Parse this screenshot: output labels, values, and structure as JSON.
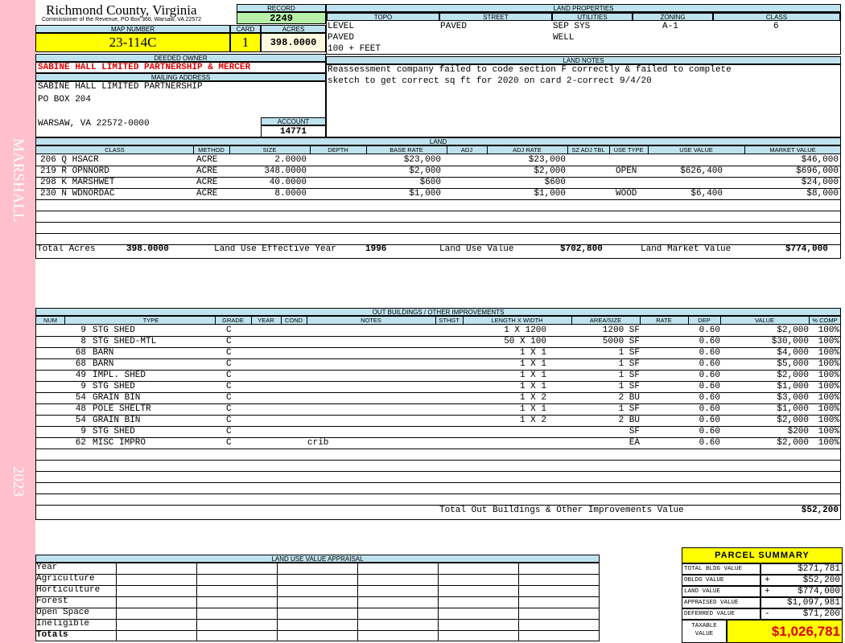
{
  "side": {
    "top": "MARSHALL",
    "bottom": "2023"
  },
  "county": {
    "title": "Richmond County, Virginia",
    "subtitle": "Commissioner of the Revenue, PO Box 366, Warsaw, VA 22572"
  },
  "record": {
    "label": "RECORD",
    "value": "2249"
  },
  "map": {
    "label": "MAP NUMBER",
    "value": "23-114C"
  },
  "card": {
    "label": "CARD",
    "value": "1"
  },
  "acres": {
    "label": "ACRES",
    "value": "398.0000"
  },
  "owner": {
    "label": "DEEDED OWNER",
    "value": "SABINE HALL LIMITED PARTNERSHIP & MERCER"
  },
  "mailing": {
    "label": "MAILING ADDRESS",
    "line1": "SABINE HALL LIMITED PARTNERSHIP",
    "line2": "PO BOX 204",
    "line3": "WARSAW, VA 22572-0000"
  },
  "account": {
    "label": "ACCOUNT",
    "value": "14771"
  },
  "land_properties": {
    "label": "LAND PROPERTIES",
    "headers": [
      "TOPO",
      "STREET",
      "UTILITIES",
      "ZONING",
      "CLASS"
    ],
    "topo": [
      "LEVEL",
      "PAVED",
      "100 + FEET"
    ],
    "street": "PAVED",
    "utilities": [
      "SEP SYS",
      "WELL"
    ],
    "zoning": "A-1",
    "class": "6"
  },
  "land_notes": {
    "label": "LAND NOTES",
    "line1": "Reassessment company failed to code section F correctly & failed to complete",
    "line2": "sketch to get correct sq ft for 2020 on card 2-correct 9/4/20"
  },
  "land": {
    "label": "LAND",
    "headers": [
      "CLASS",
      "METHOD",
      "SIZE",
      "DEPTH",
      "BASE RATE",
      "ADJ",
      "ADJ RATE",
      "SZ ADJ TBL",
      "USE TYPE",
      "USE VALUE",
      "MARKET VALUE"
    ],
    "rows": [
      {
        "class": "206 Q HSACR",
        "method": "ACRE",
        "size": "2.0000",
        "base_rate": "$23,000",
        "adj_rate": "$23,000",
        "use_type": "",
        "use_value": "",
        "market_value": "$46,000"
      },
      {
        "class": "219 R OPNNORD",
        "method": "ACRE",
        "size": "348.0000",
        "base_rate": "$2,000",
        "adj_rate": "$2,000",
        "use_type": "OPEN",
        "use_value": "$626,400",
        "market_value": "$696,000"
      },
      {
        "class": "298 K MARSHWET",
        "method": "ACRE",
        "size": "40.0000",
        "base_rate": "$600",
        "adj_rate": "$600",
        "use_type": "",
        "use_value": "",
        "market_value": "$24,000"
      },
      {
        "class": "230 N WDNORDAC",
        "method": "ACRE",
        "size": "8.0000",
        "base_rate": "$1,000",
        "adj_rate": "$1,000",
        "use_type": "WOOD",
        "use_value": "$6,400",
        "market_value": "$8,000"
      }
    ],
    "total_acres_label": "Total Acres",
    "total_acres": "398.0000",
    "effective_year_label": "Land Use Effective Year",
    "effective_year": "1996",
    "use_value_label": "Land Use Value",
    "use_value": "$702,800",
    "market_value_label": "Land Market Value",
    "market_value": "$774,000"
  },
  "outbuildings": {
    "label": "OUT BUILDINGS / OTHER IMPROVEMENTS",
    "headers": [
      "NUM",
      "TYPE",
      "GRADE",
      "YEAR",
      "COND",
      "NOTES",
      "STHGT",
      "LENGTH X WIDTH",
      "AREA/SIZE",
      "RATE",
      "DEP",
      "VALUE",
      "% COMP"
    ],
    "rows": [
      {
        "num": "9",
        "type": "STG SHED",
        "grade": "C",
        "notes": "",
        "lxw": "1 X 1200",
        "area": "1200 SF",
        "dep": "0.60",
        "value": "$2,000",
        "comp": "100%"
      },
      {
        "num": "8",
        "type": "STG SHED-MTL",
        "grade": "C",
        "notes": "",
        "lxw": "50 X 100",
        "area": "5000 SF",
        "dep": "0.60",
        "value": "$30,000",
        "comp": "100%"
      },
      {
        "num": "68",
        "type": "BARN",
        "grade": "C",
        "notes": "",
        "lxw": "1 X 1",
        "area": "1 SF",
        "dep": "0.60",
        "value": "$4,000",
        "comp": "100%"
      },
      {
        "num": "68",
        "type": "BARN",
        "grade": "C",
        "notes": "",
        "lxw": "1 X 1",
        "area": "1 SF",
        "dep": "0.60",
        "value": "$5,000",
        "comp": "100%"
      },
      {
        "num": "49",
        "type": "IMPL. SHED",
        "grade": "C",
        "notes": "",
        "lxw": "1 X 1",
        "area": "1 SF",
        "dep": "0.60",
        "value": "$2,000",
        "comp": "100%"
      },
      {
        "num": "9",
        "type": "STG SHED",
        "grade": "C",
        "notes": "",
        "lxw": "1 X 1",
        "area": "1 SF",
        "dep": "0.60",
        "value": "$1,000",
        "comp": "100%"
      },
      {
        "num": "54",
        "type": "GRAIN BIN",
        "grade": "C",
        "notes": "",
        "lxw": "1 X 2",
        "area": "2 BU",
        "dep": "0.60",
        "value": "$3,000",
        "comp": "100%"
      },
      {
        "num": "48",
        "type": "POLE SHELTR",
        "grade": "C",
        "notes": "",
        "lxw": "1 X 1",
        "area": "1 SF",
        "dep": "0.60",
        "value": "$1,000",
        "comp": "100%"
      },
      {
        "num": "54",
        "type": "GRAIN BIN",
        "grade": "C",
        "notes": "",
        "lxw": "1 X 2",
        "area": "2 BU",
        "dep": "0.60",
        "value": "$2,000",
        "comp": "100%"
      },
      {
        "num": "9",
        "type": "STG SHED",
        "grade": "C",
        "notes": "",
        "lxw": "",
        "area": "SF",
        "dep": "0.60",
        "value": "$200",
        "comp": "100%"
      },
      {
        "num": "62",
        "type": "MISC IMPRO",
        "grade": "C",
        "notes": "crib",
        "lxw": "",
        "area": "EA",
        "dep": "0.60",
        "value": "$2,000",
        "comp": "100%"
      }
    ],
    "total_label": "Total Out Buildings & Other Improvements Value",
    "total_value": "$52,200"
  },
  "luva": {
    "label": "LAND USE VALUE APPRAISAL",
    "rows": [
      "Year",
      "Agriculture",
      "Horticulture",
      "Forest",
      "Open Space",
      "Ineligible",
      "Totals"
    ]
  },
  "summary": {
    "title": "PARCEL SUMMARY",
    "rows": [
      {
        "label": "TOTAL BLDG VALUE",
        "sign": "",
        "value": "$271,781"
      },
      {
        "label": "OBLDG VALUE",
        "sign": "+",
        "value": "$52,200"
      },
      {
        "label": "LAND VALUE",
        "sign": "+",
        "value": "$774,000"
      },
      {
        "label": "APPRAISED VALUE",
        "sign": "",
        "value": "$1,097,981"
      },
      {
        "label": "DEFERRED VALUE",
        "sign": "-",
        "value": "$71,200"
      }
    ],
    "taxable_label_1": "TAXABLE",
    "taxable_label_2": "VALUE",
    "taxable_value": "$1,026,781"
  }
}
